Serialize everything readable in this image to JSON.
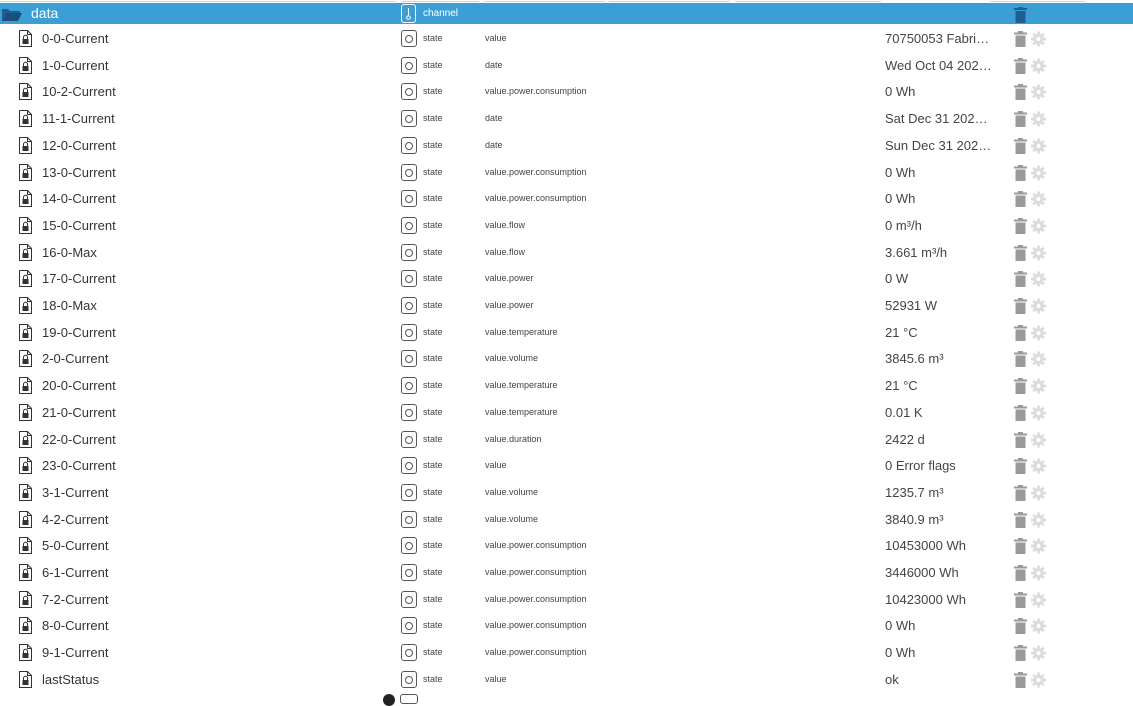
{
  "folder": {
    "name": "data",
    "type": "channel",
    "icon": "folder-open-icon"
  },
  "rows": [
    {
      "name": "0-0-Current",
      "type": "state",
      "role": "value",
      "value": "70750053 Fabri…"
    },
    {
      "name": "1-0-Current",
      "type": "state",
      "role": "date",
      "value": "Wed Oct 04 202…"
    },
    {
      "name": "10-2-Current",
      "type": "state",
      "role": "value.power.consumption",
      "value": "0 Wh"
    },
    {
      "name": "11-1-Current",
      "type": "state",
      "role": "date",
      "value": "Sat Dec 31 202…"
    },
    {
      "name": "12-0-Current",
      "type": "state",
      "role": "date",
      "value": "Sun Dec 31 202…"
    },
    {
      "name": "13-0-Current",
      "type": "state",
      "role": "value.power.consumption",
      "value": "0 Wh"
    },
    {
      "name": "14-0-Current",
      "type": "state",
      "role": "value.power.consumption",
      "value": "0 Wh"
    },
    {
      "name": "15-0-Current",
      "type": "state",
      "role": "value.flow",
      "value": "0 m³/h"
    },
    {
      "name": "16-0-Max",
      "type": "state",
      "role": "value.flow",
      "value": "3.661 m³/h"
    },
    {
      "name": "17-0-Current",
      "type": "state",
      "role": "value.power",
      "value": "0 W"
    },
    {
      "name": "18-0-Max",
      "type": "state",
      "role": "value.power",
      "value": "52931 W"
    },
    {
      "name": "19-0-Current",
      "type": "state",
      "role": "value.temperature",
      "value": "21 °C"
    },
    {
      "name": "2-0-Current",
      "type": "state",
      "role": "value.volume",
      "value": "3845.6 m³"
    },
    {
      "name": "20-0-Current",
      "type": "state",
      "role": "value.temperature",
      "value": "21 °C"
    },
    {
      "name": "21-0-Current",
      "type": "state",
      "role": "value.temperature",
      "value": "0.01 K"
    },
    {
      "name": "22-0-Current",
      "type": "state",
      "role": "value.duration",
      "value": "2422 d"
    },
    {
      "name": "23-0-Current",
      "type": "state",
      "role": "value",
      "value": "0 Error flags"
    },
    {
      "name": "3-1-Current",
      "type": "state",
      "role": "value.volume",
      "value": "1235.7 m³"
    },
    {
      "name": "4-2-Current",
      "type": "state",
      "role": "value.volume",
      "value": "3840.9 m³"
    },
    {
      "name": "5-0-Current",
      "type": "state",
      "role": "value.power.consumption",
      "value": "10453000 Wh"
    },
    {
      "name": "6-1-Current",
      "type": "state",
      "role": "value.power.consumption",
      "value": "3446000 Wh"
    },
    {
      "name": "7-2-Current",
      "type": "state",
      "role": "value.power.consumption",
      "value": "10423000 Wh"
    },
    {
      "name": "8-0-Current",
      "type": "state",
      "role": "value.power.consumption",
      "value": "0 Wh"
    },
    {
      "name": "9-1-Current",
      "type": "state",
      "role": "value.power.consumption",
      "value": "0 Wh"
    },
    {
      "name": "lastStatus",
      "type": "state",
      "role": "value",
      "value": "ok"
    }
  ],
  "icons": {
    "file": "locked-file-icon",
    "type": "state-icon",
    "delete": "trash-icon",
    "settings": "gear-icon"
  },
  "colors": {
    "selected_row": "#3b9fd6",
    "action_icon": "#9a9a9a",
    "settings_icon": "#dcdcdc"
  }
}
